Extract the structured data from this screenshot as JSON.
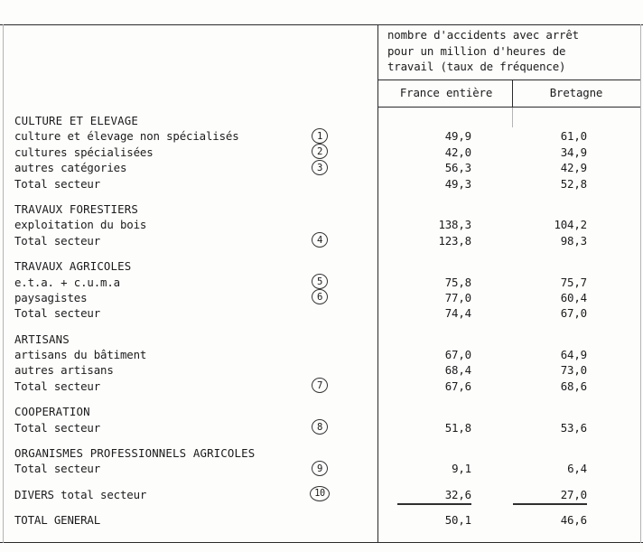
{
  "header": {
    "caption": "nombre d'accidents avec arrêt\npour un million d'heures de\ntravail (taux de fréquence)",
    "columns": [
      {
        "label": "France entière"
      },
      {
        "label": "Bretagne"
      }
    ]
  },
  "rows": [
    {
      "kind": "section",
      "label": "CULTURE ET ELEVAGE",
      "ref": "",
      "france": "",
      "bretagne": ""
    },
    {
      "kind": "item",
      "label": "culture et élevage non spécialisés",
      "ref": "1",
      "france": "49,9",
      "bretagne": "61,0"
    },
    {
      "kind": "item",
      "label": "cultures spécialisées",
      "ref": "2",
      "france": "42,0",
      "bretagne": "34,9"
    },
    {
      "kind": "item",
      "label": "autres catégories",
      "ref": "3",
      "france": "56,3",
      "bretagne": "42,9"
    },
    {
      "kind": "item",
      "label": "Total secteur",
      "ref": "",
      "france": "49,3",
      "bretagne": "52,8"
    },
    {
      "kind": "gap"
    },
    {
      "kind": "section",
      "label": "TRAVAUX FORESTIERS",
      "ref": "",
      "france": "",
      "bretagne": ""
    },
    {
      "kind": "item",
      "label": "exploitation du bois",
      "ref": "",
      "france": "138,3",
      "bretagne": "104,2"
    },
    {
      "kind": "item",
      "label": "Total secteur",
      "ref": "4",
      "france": "123,8",
      "bretagne": "98,3"
    },
    {
      "kind": "gap"
    },
    {
      "kind": "section",
      "label": "TRAVAUX AGRICOLES",
      "ref": "",
      "france": "",
      "bretagne": ""
    },
    {
      "kind": "item",
      "label": "e.t.a. + c.u.m.a",
      "ref": "5",
      "france": "75,8",
      "bretagne": "75,7"
    },
    {
      "kind": "item",
      "label": "paysagistes",
      "ref": "6",
      "france": "77,0",
      "bretagne": "60,4"
    },
    {
      "kind": "item",
      "label": "Total secteur",
      "ref": "",
      "france": "74,4",
      "bretagne": "67,0"
    },
    {
      "kind": "gap"
    },
    {
      "kind": "section",
      "label": "ARTISANS",
      "ref": "",
      "france": "",
      "bretagne": ""
    },
    {
      "kind": "item",
      "label": "artisans du bâtiment",
      "ref": "",
      "france": "67,0",
      "bretagne": "64,9"
    },
    {
      "kind": "item",
      "label": "autres artisans",
      "ref": "",
      "france": "68,4",
      "bretagne": "73,0"
    },
    {
      "kind": "item",
      "label": "Total secteur",
      "ref": "7",
      "france": "67,6",
      "bretagne": "68,6"
    },
    {
      "kind": "gap"
    },
    {
      "kind": "section",
      "label": "COOPERATION",
      "ref": "",
      "france": "",
      "bretagne": ""
    },
    {
      "kind": "item",
      "label": "Total secteur",
      "ref": "8",
      "france": "51,8",
      "bretagne": "53,6"
    },
    {
      "kind": "gap"
    },
    {
      "kind": "section",
      "label": "ORGANISMES PROFESSIONNELS AGRICOLES",
      "ref": "",
      "france": "",
      "bretagne": ""
    },
    {
      "kind": "item",
      "label": "Total secteur",
      "ref": "9",
      "france": "9,1",
      "bretagne": "6,4"
    },
    {
      "kind": "gap"
    },
    {
      "kind": "item",
      "label": "DIVERS total secteur",
      "ref": "10",
      "france": "32,6",
      "bretagne": "27,0",
      "underline": true
    },
    {
      "kind": "gap"
    },
    {
      "kind": "item",
      "label": "TOTAL GENERAL",
      "ref": "",
      "france": "50,1",
      "bretagne": "46,6"
    }
  ]
}
